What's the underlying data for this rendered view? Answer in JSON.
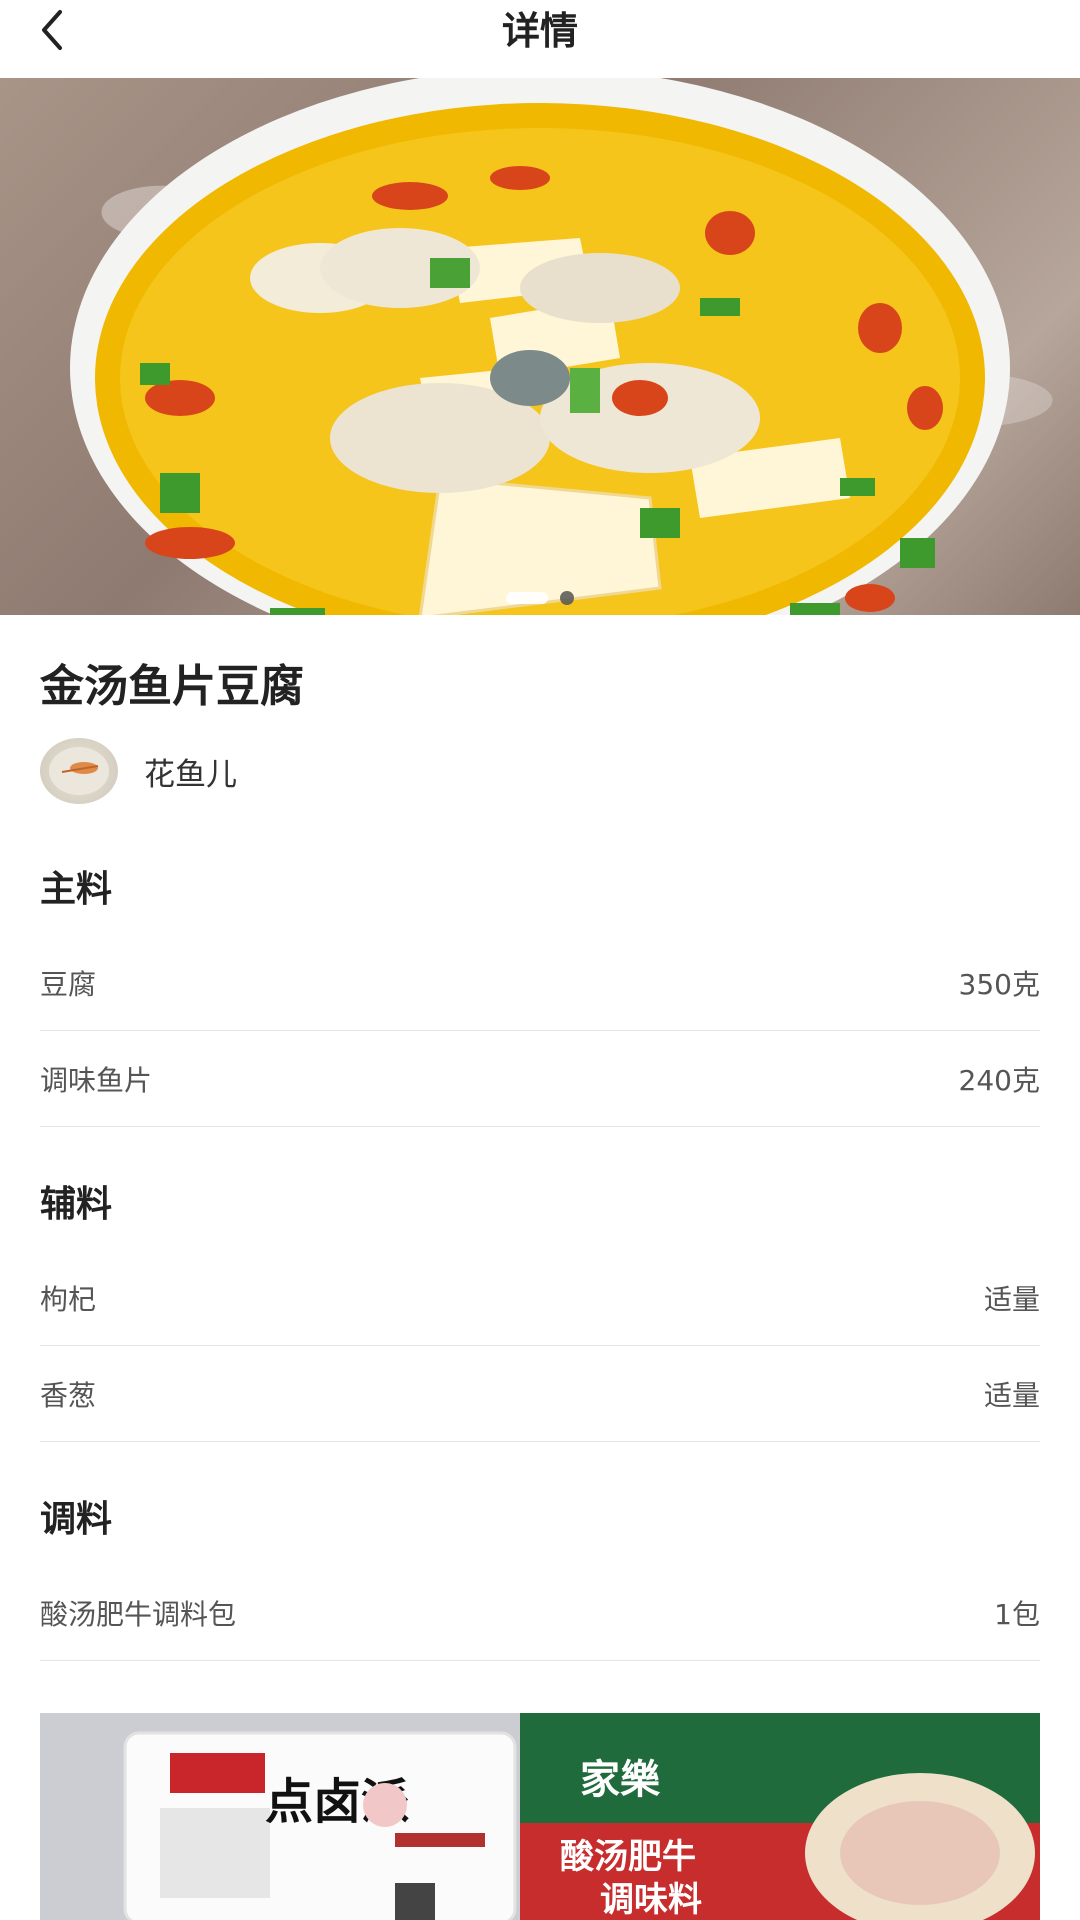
{
  "header": {
    "title": "详情",
    "back_icon": "chevron-left-icon"
  },
  "carousel": {
    "total_slides": 2,
    "active_index": 1
  },
  "recipe": {
    "title": "金汤鱼片豆腐",
    "author": {
      "name": "花鱼儿"
    }
  },
  "sections": [
    {
      "title": "主料",
      "items": [
        {
          "name": "豆腐",
          "amount": "350克"
        },
        {
          "name": "调味鱼片",
          "amount": "240克"
        }
      ]
    },
    {
      "title": "辅料",
      "items": [
        {
          "name": "枸杞",
          "amount": "适量"
        },
        {
          "name": "香葱",
          "amount": "适量"
        }
      ]
    },
    {
      "title": "调料",
      "items": [
        {
          "name": "酸汤肥牛调料包",
          "amount": "1包"
        }
      ]
    }
  ],
  "product_photo": {
    "tofu_brand": "点卤派",
    "package_brand": "家樂",
    "package_line1": "酸汤肥牛",
    "package_line2": "调味料"
  }
}
